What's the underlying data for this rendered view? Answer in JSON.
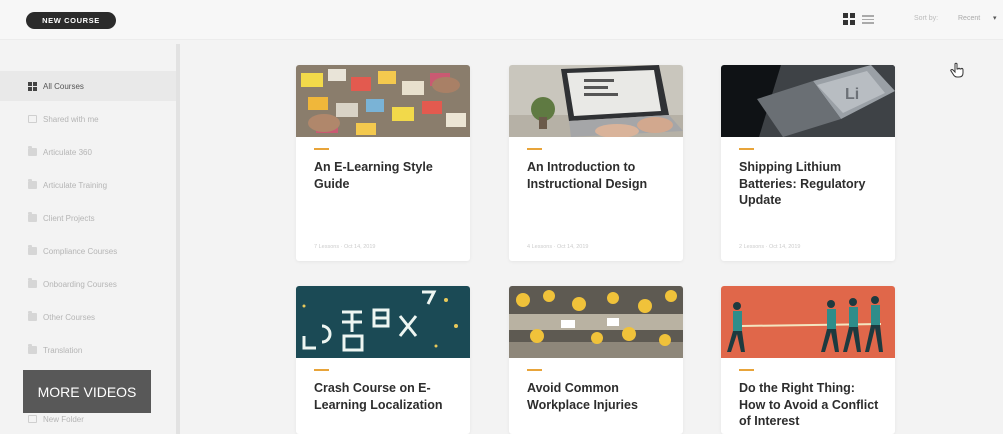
{
  "toolbar": {
    "new_course_label": "NEW COURSE",
    "grid_view_icon": "grid-view-icon",
    "list_view_icon": "list-view-icon",
    "sort_label": "Sort by:",
    "sort_value": "Recent",
    "sort_caret": "▾"
  },
  "sidebar": {
    "items": [
      {
        "label": "All Courses",
        "icon": "grid-icon",
        "active": true
      },
      {
        "label": "Shared with me",
        "icon": "shared-icon"
      },
      {
        "label": "Articulate 360",
        "icon": "folder-icon"
      },
      {
        "label": "Articulate Training",
        "icon": "folder-icon"
      },
      {
        "label": "Client Projects",
        "icon": "folder-icon"
      },
      {
        "label": "Compliance Courses",
        "icon": "folder-icon"
      },
      {
        "label": "Onboarding Courses",
        "icon": "folder-icon"
      },
      {
        "label": "Other Courses",
        "icon": "folder-icon"
      },
      {
        "label": "Translation",
        "icon": "folder-icon"
      },
      {
        "label": "New Folder",
        "icon": "new-folder-icon"
      }
    ]
  },
  "courses": [
    {
      "title": "An E-Learning Style Guide",
      "meta": "7 Lessons · Oct 14, 2019",
      "thumb": "sticky-notes-photo"
    },
    {
      "title": "An Introduction to Instructional Design",
      "meta": "4 Lessons · Oct 14, 2019",
      "thumb": "laptop-photo"
    },
    {
      "title": "Shipping Lithium Batteries: Regulatory Update",
      "meta": "2 Lessons · Oct 14, 2019",
      "thumb": "lithium-key-photo"
    },
    {
      "title": "Crash Course on E-Learning Localization",
      "meta": "",
      "thumb": "neon-sign-photo"
    },
    {
      "title": "Avoid Common Workplace Injuries",
      "meta": "",
      "thumb": "hard-hats-photo"
    },
    {
      "title": "Do the Right Thing: How to Avoid a Conflict of Interest",
      "meta": "",
      "thumb": "tug-of-war-illustration"
    }
  ],
  "overlay": {
    "more_videos_label": "MORE VIDEOS"
  },
  "colors": {
    "accent": "#e8a43a",
    "button_dark": "#2b2b2b",
    "illustration_bg": "#e0674a"
  }
}
